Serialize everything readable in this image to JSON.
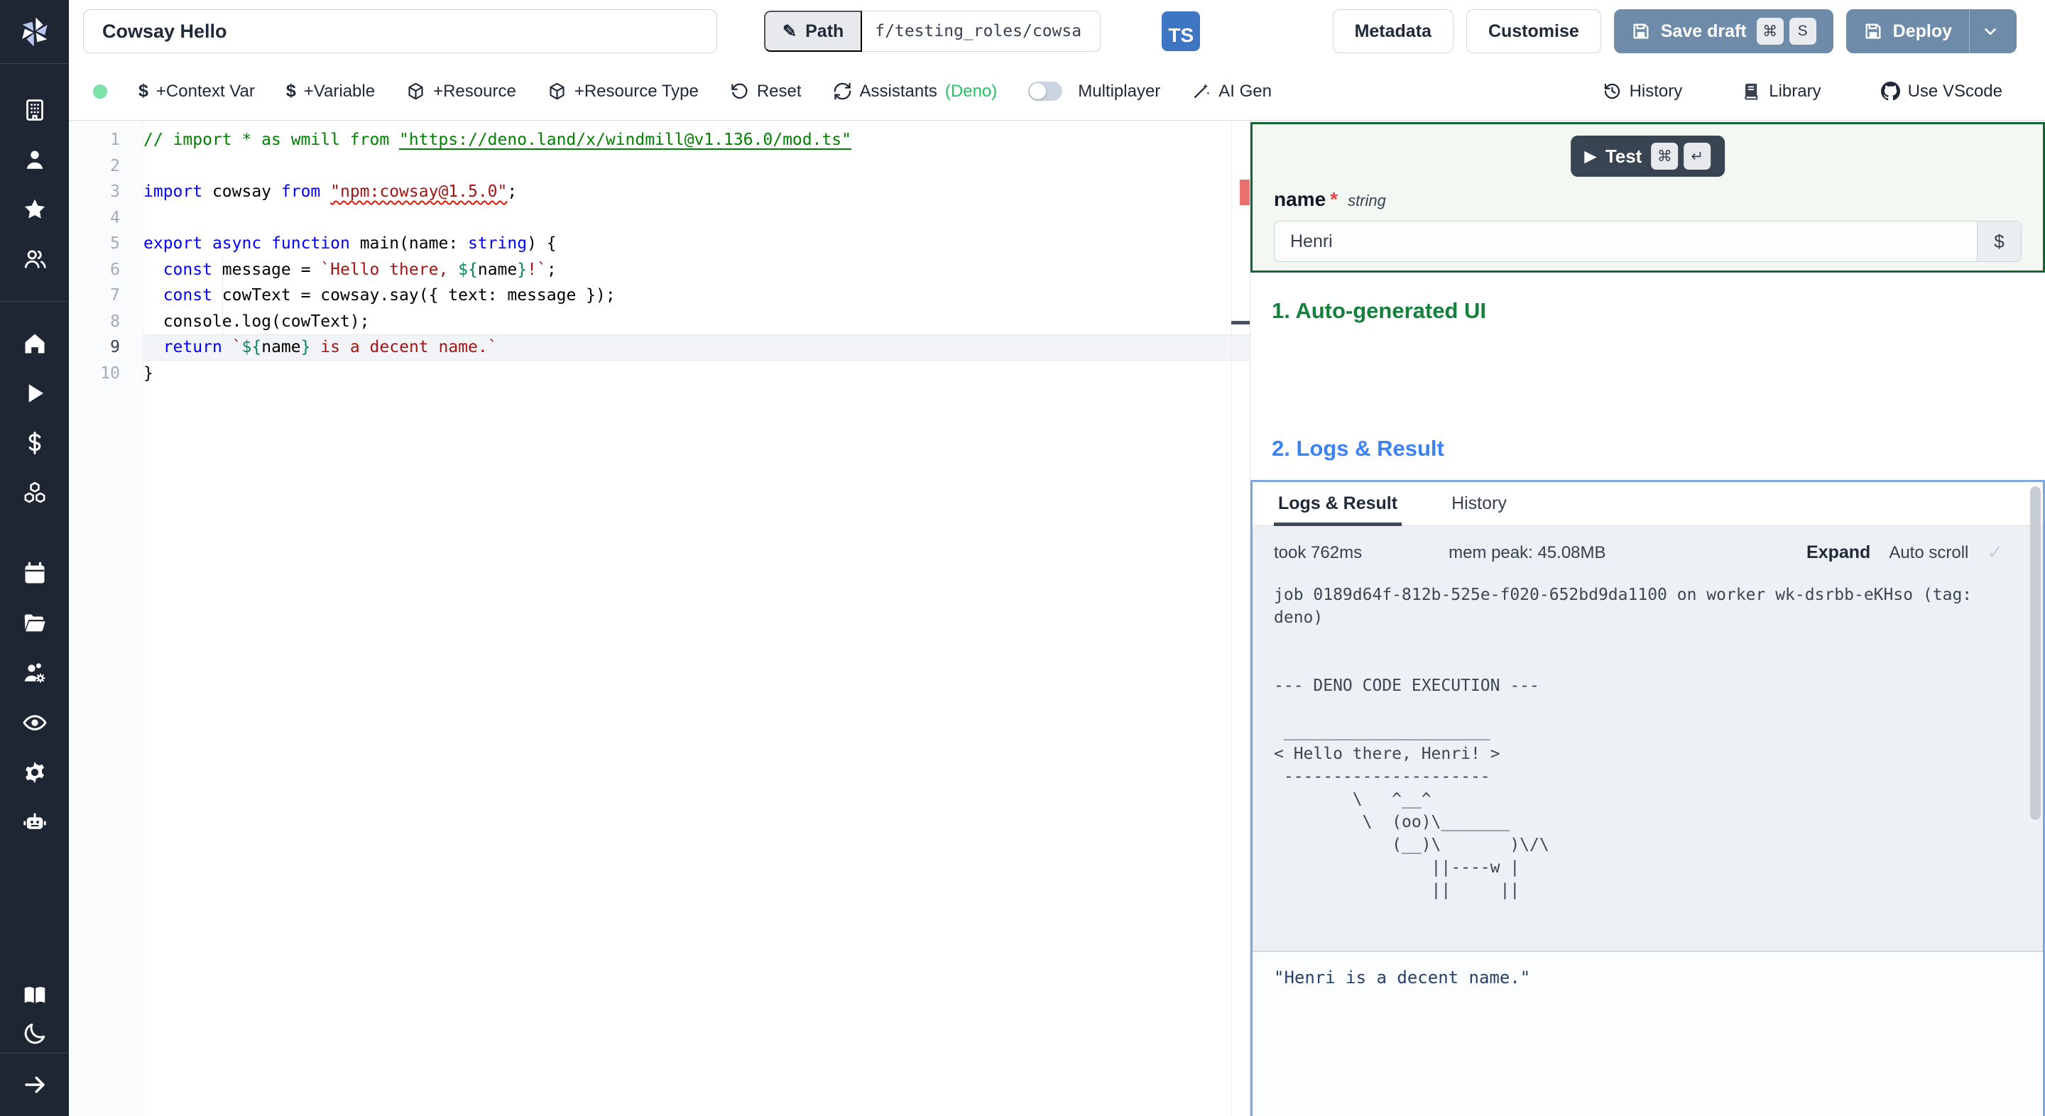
{
  "topbar": {
    "script_title": "Cowsay Hello",
    "path_label": "Path",
    "path_value": "f/testing_roles/cowsa",
    "language_badge": "TS",
    "metadata": "Metadata",
    "customise": "Customise",
    "save_draft": "Save draft",
    "save_shortcut": [
      "⌘",
      "S"
    ],
    "deploy": "Deploy"
  },
  "toolbar": {
    "dollar": "$",
    "context_var": "+Context Var",
    "variable": "+Variable",
    "resource": "+Resource",
    "resource_type": "+Resource Type",
    "reset": "Reset",
    "assistants": "Assistants",
    "assistants_runtime": "(Deno)",
    "multiplayer": "Multiplayer",
    "ai_gen": "AI Gen",
    "history": "History",
    "library": "Library",
    "use_vscode": "Use VScode"
  },
  "sidebar": {
    "groups": [
      [
        "building",
        "user",
        "star",
        "users"
      ],
      [
        "home",
        "play",
        "dollar",
        "boxes"
      ],
      [
        "calendar",
        "folder-open",
        "user-cog",
        "eye",
        "settings",
        "bot"
      ]
    ],
    "footer": [
      "book-open",
      "moon"
    ],
    "bottom": [
      "arrow-right"
    ]
  },
  "editor": {
    "lines": [
      {
        "n": 1,
        "tokens": [
          {
            "t": "// import * as wmill from ",
            "c": "cm"
          },
          {
            "t": "\"https://deno.land/x/windmill@v1.136.0/mod.ts\"",
            "c": "cm lnk"
          }
        ]
      },
      {
        "n": 2,
        "tokens": []
      },
      {
        "n": 3,
        "tokens": [
          {
            "t": "import",
            "c": "kw"
          },
          {
            "t": " cowsay ",
            "c": "df"
          },
          {
            "t": "from",
            "c": "kw"
          },
          {
            "t": " ",
            "c": "df"
          },
          {
            "t": "\"npm:cowsay@1.5.0\"",
            "c": "str err"
          },
          {
            "t": ";",
            "c": "df"
          }
        ]
      },
      {
        "n": 4,
        "tokens": []
      },
      {
        "n": 5,
        "tokens": [
          {
            "t": "export",
            "c": "kw"
          },
          {
            "t": " ",
            "c": "df"
          },
          {
            "t": "async",
            "c": "kw"
          },
          {
            "t": " ",
            "c": "df"
          },
          {
            "t": "function",
            "c": "kw"
          },
          {
            "t": " main(name: ",
            "c": "df"
          },
          {
            "t": "string",
            "c": "kw"
          },
          {
            "t": ") {",
            "c": "df"
          }
        ]
      },
      {
        "n": 6,
        "tokens": [
          {
            "t": "  ",
            "c": "df"
          },
          {
            "t": "const",
            "c": "kw"
          },
          {
            "t": " message = ",
            "c": "df"
          },
          {
            "t": "`Hello there, ",
            "c": "str"
          },
          {
            "t": "${",
            "c": "grn"
          },
          {
            "t": "name",
            "c": "df"
          },
          {
            "t": "}",
            "c": "grn"
          },
          {
            "t": "!`",
            "c": "str"
          },
          {
            "t": ";",
            "c": "df"
          }
        ]
      },
      {
        "n": 7,
        "tokens": [
          {
            "t": "  ",
            "c": "df"
          },
          {
            "t": "const",
            "c": "kw"
          },
          {
            "t": " cowText = cowsay.say({ text: message });",
            "c": "df"
          }
        ]
      },
      {
        "n": 8,
        "tokens": [
          {
            "t": "  console.log(cowText);",
            "c": "df"
          }
        ]
      },
      {
        "n": 9,
        "current": true,
        "tokens": [
          {
            "t": "  ",
            "c": "df"
          },
          {
            "t": "return",
            "c": "kw"
          },
          {
            "t": " ",
            "c": "df"
          },
          {
            "t": "`",
            "c": "str"
          },
          {
            "t": "${",
            "c": "grn"
          },
          {
            "t": "name",
            "c": "df"
          },
          {
            "t": "}",
            "c": "grn"
          },
          {
            "t": " is a decent name.`",
            "c": "str"
          }
        ]
      },
      {
        "n": 10,
        "tokens": [
          {
            "t": "}",
            "c": "df"
          }
        ]
      }
    ]
  },
  "form": {
    "test": "Test",
    "test_shortcut": [
      "⌘",
      "↵"
    ],
    "field_name": "name",
    "required_mark": "*",
    "field_type": "string",
    "field_value": "Henri",
    "var_picker": "$"
  },
  "sections": {
    "auto_ui": "1. Auto-generated UI",
    "logs_result": "2. Logs & Result"
  },
  "logs": {
    "tabs": [
      "Logs & Result",
      "History"
    ],
    "took": "took 762ms",
    "mem": "mem peak: 45.08MB",
    "expand": "Expand",
    "autoscroll": "Auto scroll",
    "check": "✓",
    "log_text": "job 0189d64f-812b-525e-f020-652bd9da1100 on worker wk-dsrbb-eKHso (tag:\ndeno)\n\n\n--- DENO CODE EXECUTION ---\n\n _____________________\n< Hello there, Henri! >\n ---------------------\n        \\   ^__^\n         \\  (oo)\\_______\n            (__)\\       )\\/\\\n                ||----w |\n                ||     ||",
    "result": "\"Henri is a decent name.\""
  }
}
